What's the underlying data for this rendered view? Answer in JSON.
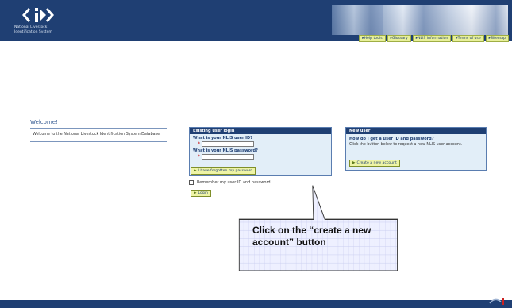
{
  "header": {
    "org_line1": "National Livestock",
    "org_line2": "Identification System",
    "nav": [
      {
        "label": "Help tools"
      },
      {
        "label": "Glossary"
      },
      {
        "label": "NLIS information"
      },
      {
        "label": "Terms of use"
      },
      {
        "label": "Sitemap"
      }
    ]
  },
  "welcome": {
    "title": "Welcome!",
    "text": "Welcome to the National Livestock Identification System Database."
  },
  "existing_login": {
    "heading": "Existing user login",
    "user_id_label": "What is your NLIS user ID?",
    "user_id_value": "",
    "password_label": "What is your NLIS password?",
    "password_value": "",
    "forgot_label": "I have forgotten my password",
    "remember_label": "Remember my user ID and password",
    "login_label": "Login"
  },
  "new_user": {
    "heading": "New user",
    "question": "How do I get a user ID and password?",
    "text": "Click the button below to request a new NLIS user account.",
    "create_label": "Create a new account"
  },
  "callout": {
    "text": "Click on the “create a new account” button"
  },
  "colors": {
    "navy": "#1f3f73",
    "button_yellow": "#eef4a6",
    "box_bg": "#e2eef8",
    "callout_bg": "#eef0ff"
  }
}
